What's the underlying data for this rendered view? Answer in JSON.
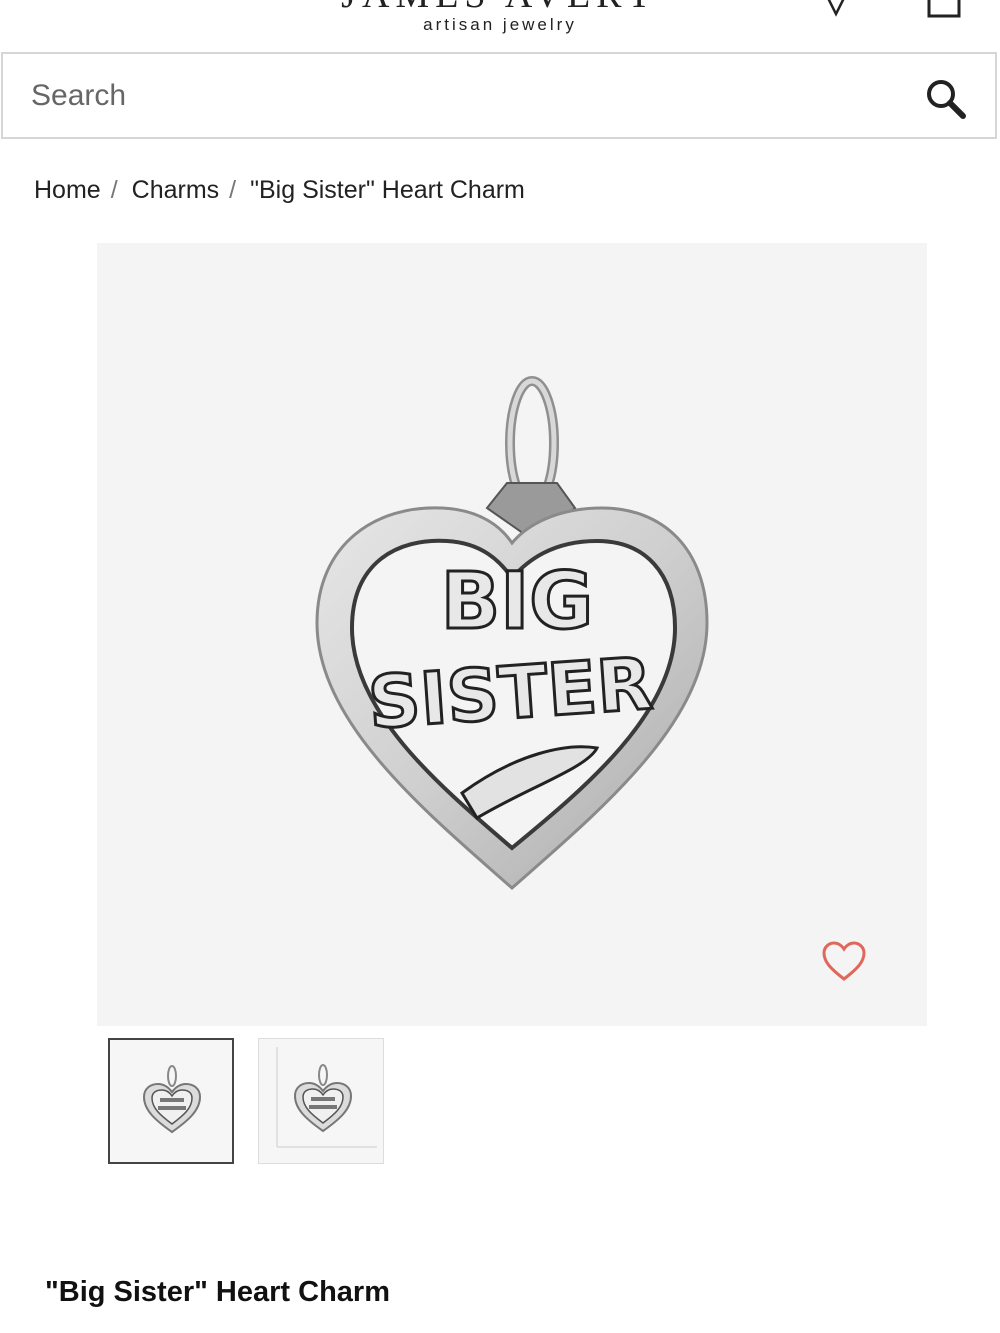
{
  "header": {
    "brand": "JAMES AVERY",
    "tagline": "artisan jewelry",
    "icons": [
      "menu-icon",
      "location-pin-icon",
      "shopping-bag-icon"
    ]
  },
  "search": {
    "placeholder": "Search",
    "icon": "search-icon"
  },
  "breadcrumb": {
    "items": [
      "Home",
      "Charms",
      "\"Big Sister\" Heart Charm"
    ],
    "separator": "/"
  },
  "product": {
    "image_text_line1": "BIG",
    "image_text_line2": "SISTER",
    "wishlist_icon": "heart-outline-icon",
    "wishlist_color": "#e0675c",
    "title": "\"Big Sister\" Heart Charm"
  },
  "thumbnails": [
    {
      "name": "thumbnail-front",
      "selected": true
    },
    {
      "name": "thumbnail-scale",
      "selected": false
    }
  ]
}
